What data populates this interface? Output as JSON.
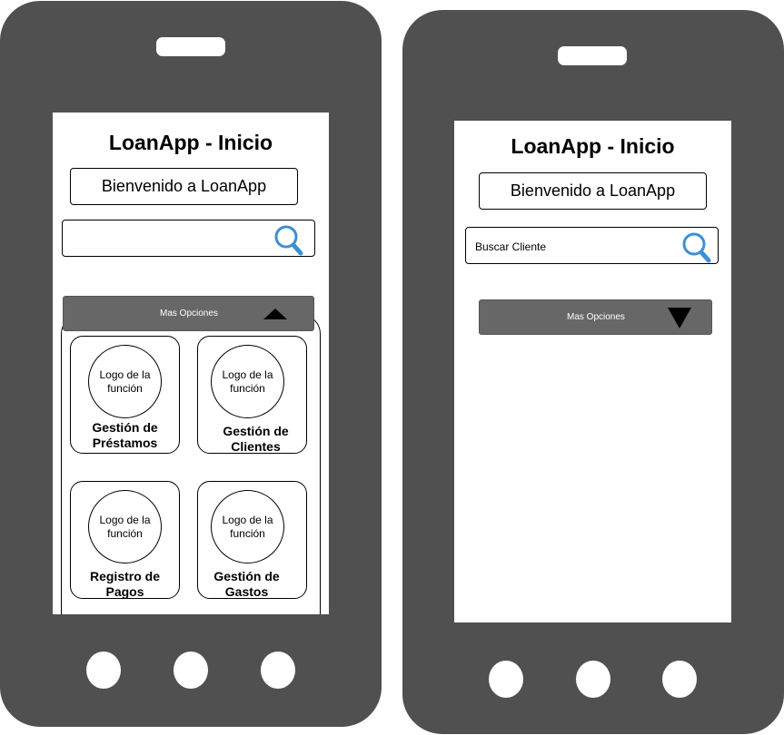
{
  "left_phone": {
    "title": "LoanApp - Inicio",
    "welcome": "Bienvenido a LoanApp",
    "search_value": "",
    "options_label": "Mas Opciones",
    "cards": [
      {
        "logo": "Logo de la función",
        "label_line1": "Gestión de",
        "label_line2": "Préstamos"
      },
      {
        "logo": "Logo de la función",
        "label_line1": "Gestión de",
        "label_line2": "Clientes"
      },
      {
        "logo": "Logo de la función",
        "label_line1": "Registro de",
        "label_line2": "Pagos"
      },
      {
        "logo": "Logo de la función",
        "label_line1": "Gestión de",
        "label_line2": "Gastos"
      }
    ]
  },
  "right_phone": {
    "title": "LoanApp - Inicio",
    "welcome": "Bienvenido a LoanApp",
    "search_value": "Buscar Cliente",
    "options_label": "Mas Opciones"
  },
  "colors": {
    "phone_body": "#505050",
    "options_bar": "#676767",
    "search_icon": "#3d8fd6"
  },
  "icons": {
    "search": "search-icon",
    "options_expanded": "triangle-up-icon",
    "options_collapsed": "triangle-down-icon"
  }
}
